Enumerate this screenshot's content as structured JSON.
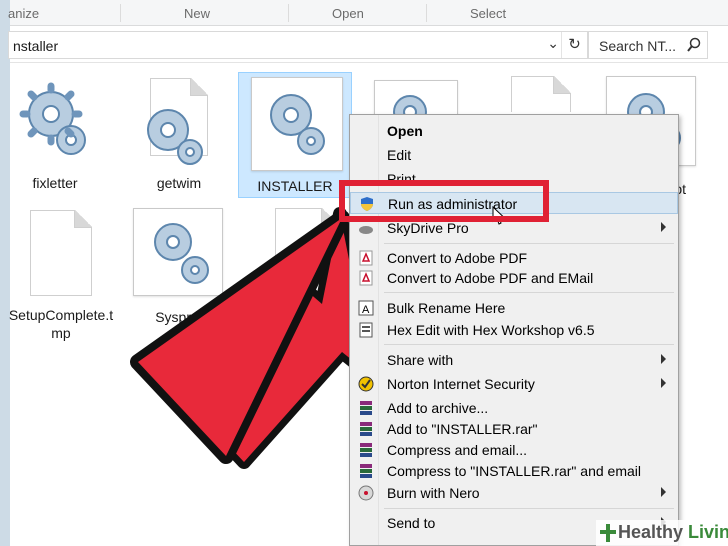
{
  "ribbon": {
    "groups": [
      "anize",
      "New",
      "Open",
      "Select"
    ]
  },
  "address": {
    "path": "nstaller",
    "search_placeholder": "Search NT..."
  },
  "files": [
    {
      "name": "fixletter",
      "kind": "gear"
    },
    {
      "name": "getwim",
      "kind": "gear-doc"
    },
    {
      "name": "INSTALLER",
      "kind": "gear",
      "selected": true
    },
    {
      "name": "",
      "kind": "gear"
    },
    {
      "name": "",
      "kind": "doc"
    },
    {
      "name": "ot",
      "kind": "gear"
    },
    {
      "name": "SetupComplete.t\nmp",
      "kind": "doc"
    },
    {
      "name": "Syspre",
      "kind": "gear"
    },
    {
      "name": "",
      "kind": "doc"
    }
  ],
  "menu": {
    "items": [
      {
        "label": "Open",
        "bold": true,
        "icon": ""
      },
      {
        "label": "Edit",
        "icon": ""
      },
      {
        "label": "Print",
        "icon": ""
      },
      {
        "label": "Run as administrator",
        "icon": "uac-shield-icon",
        "highlighted": true
      },
      {
        "label": "SkyDrive Pro",
        "icon": "skydrive-icon",
        "submenu": true
      },
      {
        "label": "Convert to Adobe PDF",
        "icon": "pdf-icon"
      },
      {
        "label": "Convert to Adobe PDF and EMail",
        "icon": "pdf-mail-icon"
      },
      {
        "label": "Bulk Rename Here",
        "icon": "rename-icon"
      },
      {
        "label": "Hex Edit with Hex Workshop v6.5",
        "icon": "hex-icon"
      },
      {
        "label": "Share with",
        "icon": "",
        "submenu": true
      },
      {
        "label": "Norton Internet Security",
        "icon": "norton-icon",
        "submenu": true
      },
      {
        "label": "Add to archive...",
        "icon": "winrar-icon"
      },
      {
        "label": "Add to \"INSTALLER.rar\"",
        "icon": "winrar-icon"
      },
      {
        "label": "Compress and email...",
        "icon": "winrar-icon"
      },
      {
        "label": "Compress to \"INSTALLER.rar\" and email",
        "icon": "winrar-icon"
      },
      {
        "label": "Burn with Nero",
        "icon": "nero-icon",
        "submenu": true
      },
      {
        "label": "Send to",
        "icon": "",
        "submenu": true
      }
    ]
  },
  "watermark": {
    "text_a": "Healthy",
    "text_b": "Living"
  },
  "colors": {
    "highlight_box": "#e02134",
    "arrow": "#e8293a",
    "selection": "#cde8ff"
  }
}
